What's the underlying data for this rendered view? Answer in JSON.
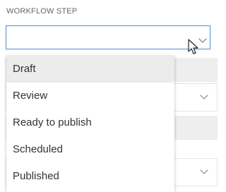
{
  "field": {
    "label": "WORKFLOW STEP",
    "value": ""
  },
  "dropdown": {
    "options": [
      "Draft",
      "Review",
      "Ready to publish",
      "Scheduled",
      "Published"
    ],
    "highlighted": "Draft"
  },
  "icons": {
    "chevron": "chevron-down-icon",
    "cursor": "mouse-pointer-icon"
  },
  "colors": {
    "focus_border": "#4a8fd6",
    "highlight": "#ececec"
  }
}
